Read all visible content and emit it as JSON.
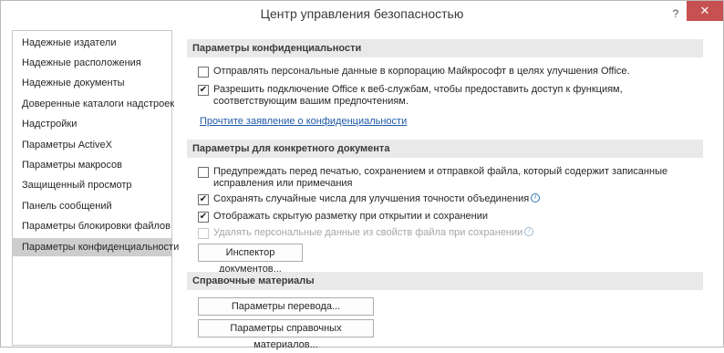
{
  "window": {
    "title": "Центр управления безопасностью",
    "help_glyph": "?",
    "close_glyph": "✕"
  },
  "sidebar": {
    "items": [
      {
        "label": "Надежные издатели"
      },
      {
        "label": "Надежные расположения"
      },
      {
        "label": "Надежные документы"
      },
      {
        "label": "Доверенные каталоги надстроек"
      },
      {
        "label": "Надстройки"
      },
      {
        "label": "Параметры ActiveX"
      },
      {
        "label": "Параметры макросов"
      },
      {
        "label": "Защищенный просмотр"
      },
      {
        "label": "Панель сообщений"
      },
      {
        "label": "Параметры блокировки файлов"
      },
      {
        "label": "Параметры конфиденциальности",
        "selected": true
      }
    ]
  },
  "privacy": {
    "header": "Параметры конфиденциальности",
    "options": [
      {
        "label": "Отправлять персональные данные в корпорацию Майкрософт в целях улучшения Office.",
        "checked": false
      },
      {
        "label": "Разрешить подключение Office к веб-службам, чтобы предоставить доступ к функциям, соответствующим вашим предпочтениям.",
        "checked": true
      }
    ],
    "link": "Прочтите заявление о конфиденциальности"
  },
  "document": {
    "header": "Параметры для конкретного документа",
    "options": [
      {
        "label": "Предупреждать перед печатью, сохранением и отправкой файла, который содержит записанные исправления или примечания",
        "checked": false
      },
      {
        "label": "Сохранять случайные числа для улучшения точности объединения",
        "checked": true,
        "info": "i"
      },
      {
        "label": "Отображать скрытую разметку при открытии и сохранении",
        "checked": true
      },
      {
        "label": "Удалять персональные данные из свойств файла при сохранении",
        "checked": false,
        "disabled": true,
        "info": "i"
      }
    ],
    "inspector_button": "Инспектор документов..."
  },
  "research": {
    "header": "Справочные материалы",
    "translation_button": "Параметры перевода...",
    "research_button": "Параметры справочных материалов..."
  },
  "check_glyph": "✔"
}
